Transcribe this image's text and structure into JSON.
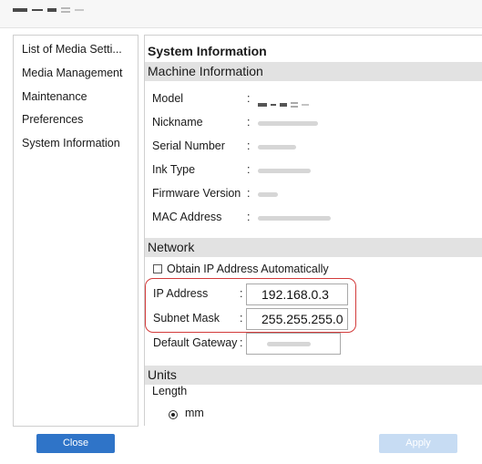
{
  "sidebar": {
    "items": [
      {
        "label": "List of Media Setti..."
      },
      {
        "label": "Media Management"
      },
      {
        "label": "Maintenance"
      },
      {
        "label": "Preferences"
      },
      {
        "label": "System Information"
      }
    ]
  },
  "main": {
    "title": "System Information",
    "machine": {
      "heading": "Machine Information",
      "fields": [
        {
          "label": "Model"
        },
        {
          "label": "Nickname"
        },
        {
          "label": "Serial Number"
        },
        {
          "label": "Ink Type"
        },
        {
          "label": "Firmware Version"
        },
        {
          "label": "MAC Address"
        }
      ]
    },
    "network": {
      "heading": "Network",
      "obtain_auto_label": "Obtain IP Address Automatically",
      "ip_label": "IP Address",
      "ip_value": "192.168.0.3",
      "subnet_label": "Subnet Mask",
      "subnet_value": "255.255.255.0",
      "gateway_label": "Default Gateway"
    },
    "units": {
      "heading": "Units",
      "length_label": "Length",
      "mm_label": "mm"
    }
  },
  "buttons": {
    "close": "Close",
    "apply": "Apply"
  },
  "colon": ":"
}
